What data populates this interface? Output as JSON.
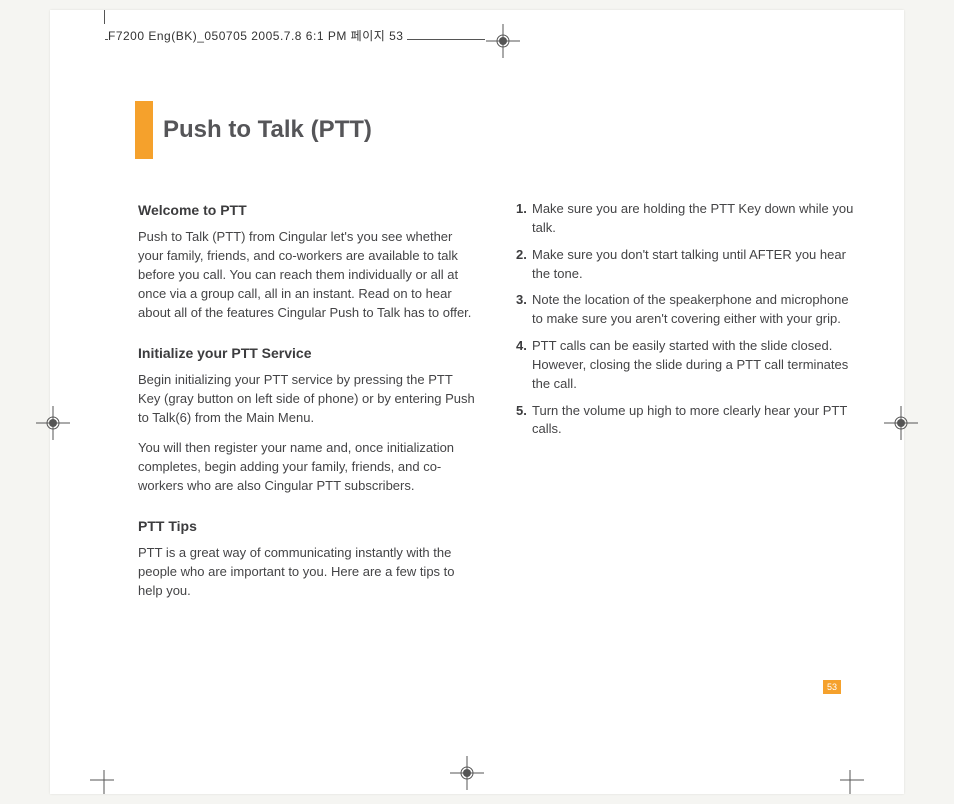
{
  "header": {
    "slug": "F7200 Eng(BK)_050705  2005.7.8  6:1 PM  페이지 53"
  },
  "title": "Push to Talk (PTT)",
  "pageNumber": "53",
  "left": {
    "h1": "Welcome to PTT",
    "p1": "Push to Talk (PTT) from Cingular let's you see whether your family, friends, and co-workers are available to talk before you call. You can reach them individually or all at once via a group call, all in an instant. Read on to hear about all of the features Cingular Push to Talk has to offer.",
    "h2": "Initialize your PTT Service",
    "p2": "Begin initializing your PTT service by pressing the PTT Key (gray button on left side of phone) or by entering Push to Talk(6) from the Main Menu.",
    "p3": "You will then register your name and, once initialization completes, begin adding your family, friends, and co-workers who are also Cingular PTT subscribers.",
    "h3": "PTT Tips",
    "p4": "PTT is a great way of communicating instantly with the people who are important to you. Here are a few tips to help you."
  },
  "right": {
    "items": [
      {
        "n": "1.",
        "t": "Make sure you are holding the PTT Key down while you talk."
      },
      {
        "n": "2.",
        "t": "Make sure you don't start talking until AFTER you hear the tone."
      },
      {
        "n": "3.",
        "t": "Note the location of the speakerphone and microphone to make sure you aren't covering either with your grip."
      },
      {
        "n": "4.",
        "t": "PTT calls can be easily started with the slide closed. However, closing the slide during a PTT call terminates the call."
      },
      {
        "n": "5.",
        "t": "Turn the volume up high to more clearly hear your PTT calls."
      }
    ]
  }
}
